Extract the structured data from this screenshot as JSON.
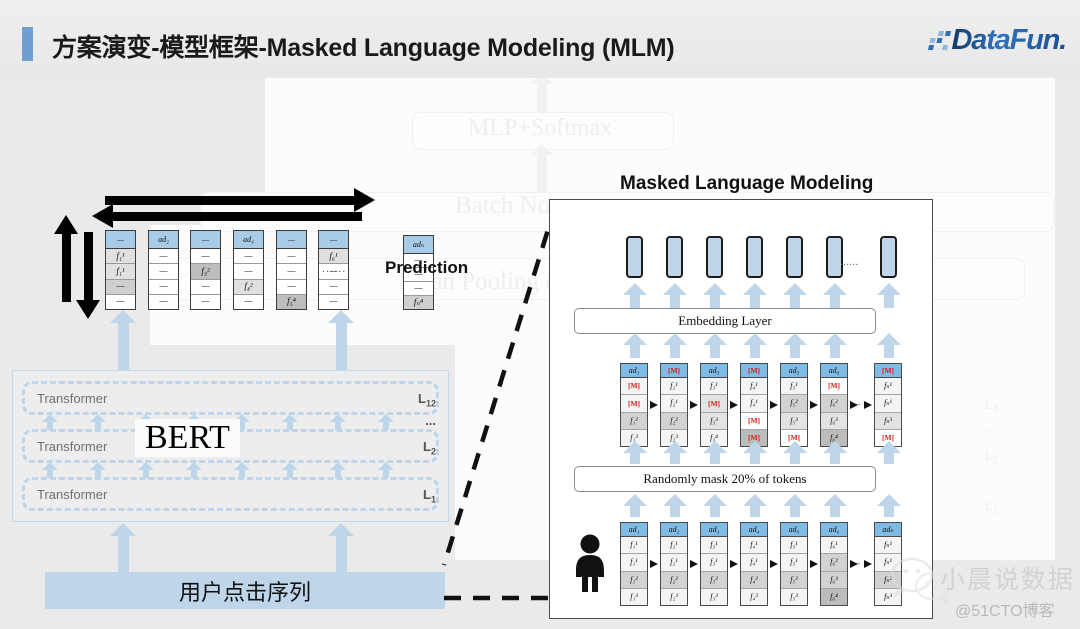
{
  "header": {
    "title": "方案演变-模型框架-Masked Language Modeling (MLM)",
    "logo_text": "DataFun.",
    "accent_color": "#6f9fd0"
  },
  "background_ghost": {
    "mlp_softmax": "MLP+Softmax",
    "batch_norm": "Batch Norm",
    "mean_pooling": "Mean Pooling &",
    "layer_labels": [
      "L4",
      "...",
      "L2",
      "L1"
    ]
  },
  "bert_diagram": {
    "prediction_label": "Prediction",
    "bert_word": "BERT",
    "click_sequence_label": "用户点击序列",
    "transformer_rows": [
      {
        "label": "Transformer",
        "layer": "L",
        "sub": "12"
      },
      {
        "label": "Transformer",
        "layer": "L",
        "sub": "2"
      },
      {
        "label": "Transformer",
        "layer": "L",
        "sub": "1"
      }
    ],
    "ellipsis": "...",
    "token_ellipsis": "......",
    "prediction_columns": [
      {
        "header": "—",
        "cells": [
          "f₁¹",
          "f₁¹",
          "—",
          "—"
        ],
        "shades": [
          "g2",
          "g2",
          "g3",
          "wh"
        ]
      },
      {
        "header": "ad₂",
        "cells": [
          "—",
          "—",
          "—",
          "—"
        ],
        "shades": [
          "wh",
          "wh",
          "wh",
          "wh"
        ]
      },
      {
        "header": "—",
        "cells": [
          "—",
          "f₃²",
          "—",
          "—"
        ],
        "shades": [
          "wh",
          "g4",
          "wh",
          "wh"
        ]
      },
      {
        "header": "ad₄",
        "cells": [
          "—",
          "—",
          "f₄²",
          "—"
        ],
        "shades": [
          "wh",
          "wh",
          "g2",
          "wh"
        ]
      },
      {
        "header": "—",
        "cells": [
          "—",
          "—",
          "—",
          "f₅⁴"
        ],
        "shades": [
          "wh",
          "wh",
          "wh",
          "g4"
        ]
      },
      {
        "header": "—",
        "cells": [
          "f₆¹",
          "—",
          "—",
          "—"
        ],
        "shades": [
          "g2",
          "wh",
          "wh",
          "wh"
        ]
      },
      {
        "header": "adₙ",
        "cells": [
          "—",
          "—",
          "—",
          "fₙ⁴"
        ],
        "shades": [
          "wh",
          "wh",
          "wh",
          "g3"
        ]
      }
    ]
  },
  "mlm_panel": {
    "title": "Masked Language Modeling",
    "embedding_layer_label": "Embedding Layer",
    "mask_rule_label": "Randomly mask 20% of tokens",
    "output_token_count": 7,
    "ellipsis": "......",
    "chain_ellipsis": "...",
    "masked_columns": [
      {
        "header": "ad₁",
        "header_masked": false,
        "cells": [
          "[M]",
          "[M]",
          "f₁²",
          "f₁³"
        ],
        "masked": [
          true,
          true,
          false,
          false
        ],
        "shades": [
          "g1",
          "g1",
          "g3",
          "g1"
        ]
      },
      {
        "header": "[M]",
        "header_masked": true,
        "cells": [
          "f₂¹",
          "f₂¹",
          "f₂²",
          "f₂³"
        ],
        "masked": [
          false,
          false,
          false,
          false
        ],
        "shades": [
          "g1",
          "g1",
          "g3",
          "g1"
        ]
      },
      {
        "header": "ad₃",
        "header_masked": false,
        "cells": [
          "f₃¹",
          "[M]",
          "f₃³",
          "f₃⁴"
        ],
        "masked": [
          false,
          true,
          false,
          false
        ],
        "shades": [
          "g1",
          "g2",
          "g2",
          "g1"
        ]
      },
      {
        "header": "[M]",
        "header_masked": true,
        "cells": [
          "f₄¹",
          "f₄¹",
          "[M]",
          "[M]"
        ],
        "masked": [
          false,
          false,
          true,
          true
        ],
        "shades": [
          "g1",
          "g1",
          "wh",
          "g4"
        ]
      },
      {
        "header": "ad₅",
        "header_masked": false,
        "cells": [
          "f₅¹",
          "f₅²",
          "f₅³",
          "[M]"
        ],
        "masked": [
          false,
          false,
          false,
          true
        ],
        "shades": [
          "g1",
          "g3",
          "g2",
          "wh"
        ]
      },
      {
        "header": "ad₆",
        "header_masked": false,
        "cells": [
          "[M]",
          "f₆²",
          "f₆³",
          "f₆⁴"
        ],
        "masked": [
          true,
          false,
          false,
          false
        ],
        "shades": [
          "wh",
          "g3",
          "g2",
          "g4"
        ]
      },
      {
        "header": "[M]",
        "header_masked": true,
        "cells": [
          "fₙ¹",
          "fₙ¹",
          "fₙ³",
          "[M]"
        ],
        "masked": [
          false,
          false,
          false,
          true
        ],
        "shades": [
          "g1",
          "g1",
          "g2",
          "wh"
        ]
      }
    ],
    "input_columns": [
      {
        "header": "ad₁",
        "cells": [
          "f₁¹",
          "f₁¹",
          "f₁²",
          "f₁³"
        ],
        "shades": [
          "g1",
          "g1",
          "g3",
          "g1"
        ]
      },
      {
        "header": "ad₂",
        "cells": [
          "f₂¹",
          "f₂¹",
          "f₂²",
          "f₂³"
        ],
        "shades": [
          "g1",
          "g1",
          "g3",
          "g1"
        ]
      },
      {
        "header": "ad₃",
        "cells": [
          "f₃¹",
          "f₃¹",
          "f₃²",
          "f₃³"
        ],
        "shades": [
          "g1",
          "g1",
          "g3",
          "g1"
        ]
      },
      {
        "header": "ad₄",
        "cells": [
          "f₄¹",
          "f₄¹",
          "f₄²",
          "f₄³"
        ],
        "shades": [
          "g1",
          "g1",
          "g3",
          "g1"
        ]
      },
      {
        "header": "ad₅",
        "cells": [
          "f₅¹",
          "f₅¹",
          "f₅²",
          "f₅³"
        ],
        "shades": [
          "g1",
          "g1",
          "g3",
          "g1"
        ]
      },
      {
        "header": "ad₆",
        "cells": [
          "f₆¹",
          "f₆²",
          "f₆³",
          "f₆⁴"
        ],
        "shades": [
          "g1",
          "g3",
          "g3",
          "g4"
        ]
      },
      {
        "header": "adₙ",
        "cells": [
          "fₙ¹",
          "fₙ¹",
          "fₙ²",
          "fₙ³"
        ],
        "shades": [
          "g1",
          "g1",
          "g3",
          "g1"
        ]
      }
    ],
    "person_icon": "person-icon"
  },
  "watermarks": {
    "wechat_name": "小晨说数据",
    "site": "@51CTO博客"
  },
  "colors": {
    "accent_blue": "#6f9fd0",
    "light_blue": "#bed5ea",
    "token_header_blue": "#7fbce5",
    "mask_red": "#e01b1b"
  }
}
